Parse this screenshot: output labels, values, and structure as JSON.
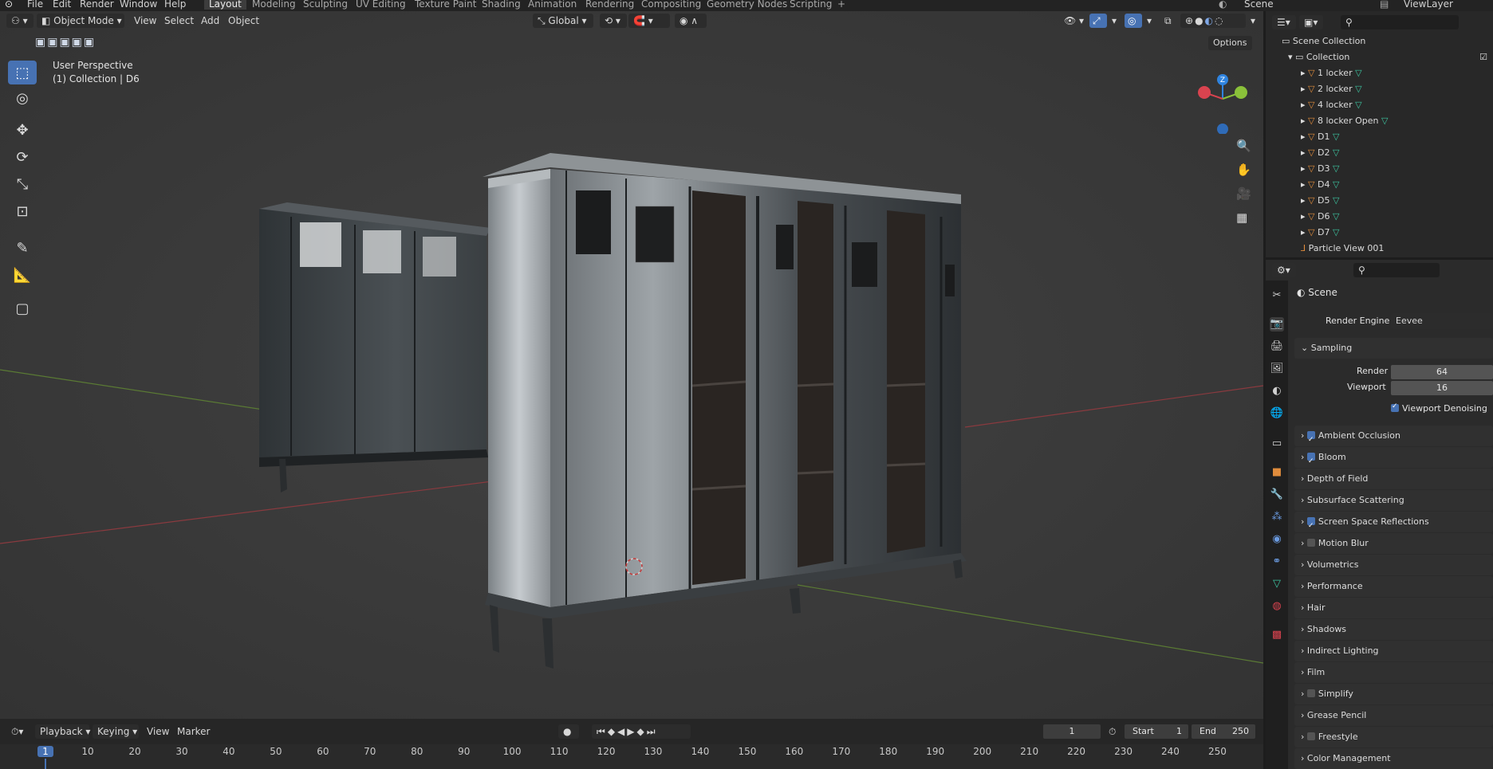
{
  "menus": [
    "File",
    "Edit",
    "Render",
    "Window",
    "Help"
  ],
  "workspaces": [
    "Layout",
    "Modeling",
    "Sculpting",
    "UV Editing",
    "Texture Paint",
    "Shading",
    "Animation",
    "Rendering",
    "Compositing",
    "Geometry Nodes",
    "Scripting"
  ],
  "active_workspace": "Layout",
  "scene_name": "Scene",
  "view_layer": "ViewLayer",
  "viewport": {
    "mode": "Object Mode",
    "menus": [
      "View",
      "Select",
      "Add",
      "Object"
    ],
    "orientation": "Global",
    "options_label": "Options",
    "overlay_title": "User Perspective",
    "overlay_subtitle": "(1) Collection | D6",
    "gizmo_axis_label": "Z"
  },
  "outliner": {
    "scene_collection": "Scene Collection",
    "collection": "Collection",
    "items": [
      "1 locker",
      "2 locker",
      "4 locker",
      "8 locker Open",
      "D1",
      "D2",
      "D3",
      "D4",
      "D5",
      "D6",
      "D7",
      "Particle View 001"
    ],
    "selected_item": "D6"
  },
  "properties": {
    "context": "Scene",
    "render_engine_label": "Render Engine",
    "render_engine": "Eevee",
    "sampling": {
      "title": "Sampling",
      "render_label": "Render",
      "render_value": "64",
      "viewport_label": "Viewport",
      "viewport_value": "16",
      "denoise_label": "Viewport Denoising"
    },
    "panels": [
      {
        "label": "Ambient Occlusion",
        "checkbox": true,
        "checked": true
      },
      {
        "label": "Bloom",
        "checkbox": true,
        "checked": true
      },
      {
        "label": "Depth of Field",
        "checkbox": false,
        "checked": false
      },
      {
        "label": "Subsurface Scattering",
        "checkbox": false,
        "checked": false
      },
      {
        "label": "Screen Space Reflections",
        "checkbox": true,
        "checked": true
      },
      {
        "label": "Motion Blur",
        "checkbox": true,
        "checked": false
      },
      {
        "label": "Volumetrics",
        "checkbox": false,
        "checked": false
      },
      {
        "label": "Performance",
        "checkbox": false,
        "checked": false
      },
      {
        "label": "Hair",
        "checkbox": false,
        "checked": false
      },
      {
        "label": "Shadows",
        "checkbox": false,
        "checked": false
      },
      {
        "label": "Indirect Lighting",
        "checkbox": false,
        "checked": false
      },
      {
        "label": "Film",
        "checkbox": false,
        "checked": false
      },
      {
        "label": "Simplify",
        "checkbox": true,
        "checked": false
      },
      {
        "label": "Grease Pencil",
        "checkbox": false,
        "checked": false
      },
      {
        "label": "Freestyle",
        "checkbox": true,
        "checked": false
      },
      {
        "label": "Color Management",
        "checkbox": false,
        "checked": false
      }
    ]
  },
  "timeline": {
    "menus": [
      "Playback",
      "Keying",
      "View",
      "Marker"
    ],
    "current_frame": "1",
    "start_label": "Start",
    "start_value": "1",
    "end_label": "End",
    "end_value": "250",
    "ticks": [
      "1",
      "10",
      "20",
      "30",
      "40",
      "50",
      "60",
      "70",
      "80",
      "90",
      "100",
      "110",
      "120",
      "130",
      "140",
      "150",
      "160",
      "170",
      "180",
      "190",
      "200",
      "210",
      "220",
      "230",
      "240",
      "250"
    ]
  },
  "colors": {
    "accent": "#4772b3",
    "object_orange": "#e08c3c",
    "mesh_green": "#3dc4a0",
    "axis_x": "#d9434f",
    "axis_y": "#8ac13a",
    "axis_z": "#2f84e0"
  }
}
